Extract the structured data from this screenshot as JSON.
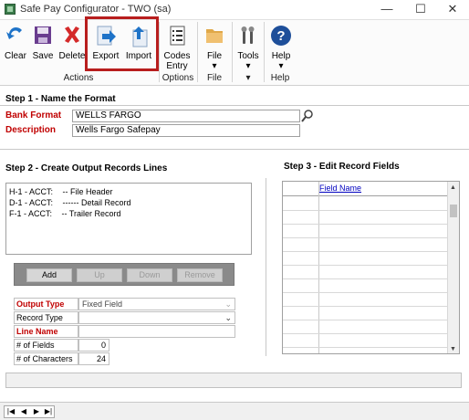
{
  "window": {
    "title": "Safe Pay Configurator  -  TWO (sa)",
    "minimize": "—",
    "maximize": "☐",
    "close": "✕"
  },
  "ribbon": {
    "clear": "Clear",
    "save": "Save",
    "delete": "Delete",
    "export": "Export",
    "import": "Import",
    "codes_entry_line1": "Codes",
    "codes_entry_line2": "Entry",
    "file": "File",
    "tools": "Tools",
    "help": "Help",
    "groups": {
      "actions": "Actions",
      "options": "Options",
      "file": "File",
      "tools": "▾",
      "help": "Help"
    },
    "highlight_color": "#b81e1e"
  },
  "step1": {
    "heading": "Step 1 - Name the Format",
    "bank_format_label": "Bank Format",
    "bank_format_value": "WELLS FARGO",
    "description_label": "Description",
    "description_value": "Wells Fargo Safepay"
  },
  "step2": {
    "heading": "Step 2 - Create Output Records Lines",
    "records": [
      {
        "code": "H-1 - ACCT:",
        "text": "-- File Header"
      },
      {
        "code": "D-1 - ACCT:",
        "text": "------ Detail Record"
      },
      {
        "code": "F-1 - ACCT:",
        "text": "-- Trailer Record"
      }
    ],
    "buttons": {
      "add": "Add",
      "up": "Up",
      "down": "Down",
      "remove": "Remove"
    },
    "output_type_label": "Output Type",
    "output_type_value": "Fixed Field",
    "record_type_label": "Record Type",
    "record_type_value": "",
    "line_name_label": "Line Name",
    "line_name_value": "",
    "num_fields_label": "# of Fields",
    "num_fields_value": "0",
    "num_chars_label": "# of Characters",
    "num_chars_value": "24"
  },
  "step3": {
    "heading": "Step 3 - Edit Record Fields",
    "column_header": "Field Name"
  },
  "nav": {
    "first": "|◀",
    "prev": "◀",
    "next": "▶",
    "last": "▶|"
  },
  "colors": {
    "required_label": "#c00000",
    "link_header": "#0000c0"
  }
}
